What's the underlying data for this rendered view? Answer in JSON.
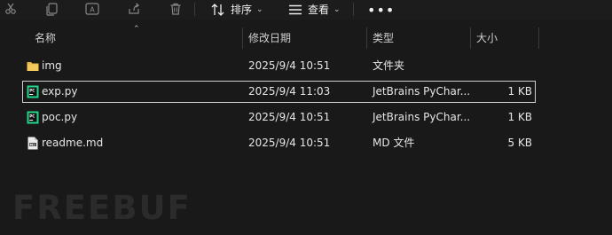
{
  "toolbar": {
    "sort_label": "排序",
    "view_label": "查看",
    "more_label": "•••"
  },
  "columns": {
    "name": "名称",
    "modified": "修改日期",
    "type": "类型",
    "size": "大小"
  },
  "files": [
    {
      "name": "img",
      "modified": "2025/9/4 10:51",
      "type": "文件夹",
      "size": "",
      "icon": "folder-icon"
    },
    {
      "name": "exp.py",
      "modified": "2025/9/4 11:03",
      "type": "JetBrains PyChar...",
      "size": "1 KB",
      "icon": "pycharm-file-icon"
    },
    {
      "name": "poc.py",
      "modified": "2025/9/4 10:51",
      "type": "JetBrains PyChar...",
      "size": "1 KB",
      "icon": "pycharm-file-icon"
    },
    {
      "name": "readme.md",
      "modified": "2025/9/4 10:51",
      "type": "MD 文件",
      "size": "5 KB",
      "icon": "markdown-file-icon"
    }
  ],
  "selected_file": "exp.py",
  "watermark": "FREEBUF",
  "colors": {
    "background": "#191919",
    "folder": "#e8b84a",
    "pycharm": "#21d789"
  }
}
